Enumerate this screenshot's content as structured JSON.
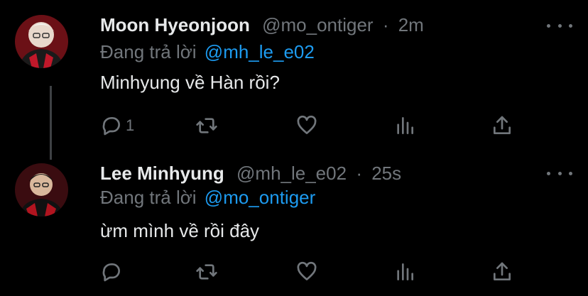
{
  "tweets": [
    {
      "name": "Moon Hyeonjoon",
      "handle": "@mo_ontiger",
      "separator": "·",
      "time": "2m",
      "replying_prefix": "Đang trả lời",
      "replying_to": "@mh_le_e02",
      "text": "Minhyung về Hàn rồi?",
      "reply_count": "1",
      "avatar": "avatar-photo"
    },
    {
      "name": "Lee Minhyung",
      "handle": "@mh_le_e02",
      "separator": "·",
      "time": "25s",
      "replying_prefix": "Đang trả lời",
      "replying_to": "@mo_ontiger",
      "text": "ừm mình về rồi đây",
      "reply_count": "",
      "avatar": "avatar-photo"
    }
  ],
  "colors": {
    "background": "#000000",
    "primary_text": "#e7e9ea",
    "secondary_text": "#71767b",
    "link": "#1d9bf0"
  },
  "icons": [
    "reply-icon",
    "retweet-icon",
    "like-icon",
    "analytics-icon",
    "share-icon",
    "more-icon"
  ]
}
